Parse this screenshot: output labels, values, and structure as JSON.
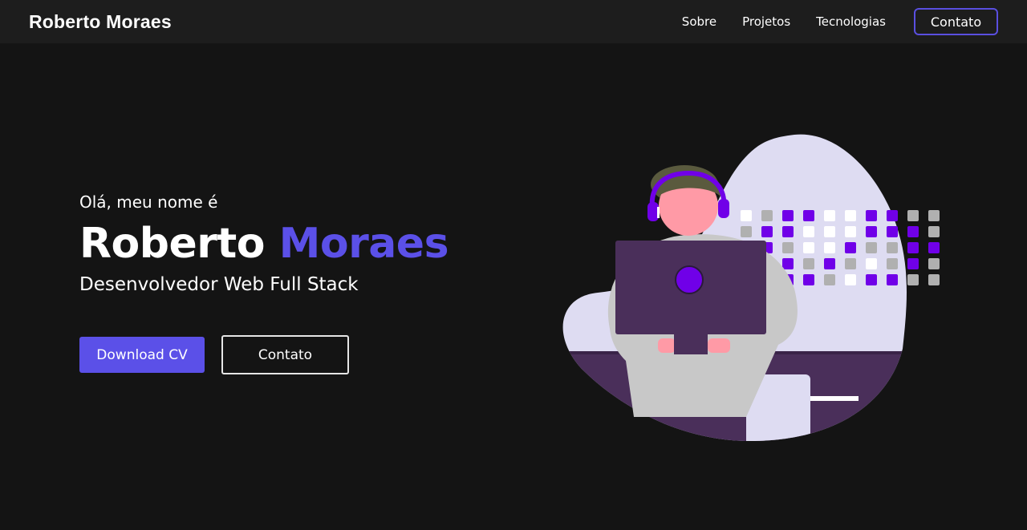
{
  "navbar": {
    "brand": "Roberto Moraes",
    "links": [
      "Sobre",
      "Projetos",
      "Tecnologias"
    ],
    "contact_label": "Contato"
  },
  "hero": {
    "greeting": "Olá, meu nome é",
    "name_first": "Roberto",
    "name_last": "Moraes",
    "role": "Desenvolvedor Web Full Stack",
    "download_label": "Download CV",
    "contact_label": "Contato"
  },
  "colors": {
    "background": "#141414",
    "navbar": "#1d1d1d",
    "accent": "#5b50e8",
    "blob": "#dedcf2",
    "desk": "#4a2f5a",
    "pixel_purple": "#7000e8",
    "pixel_gray": "#b0b0b0",
    "pixel_white": "#ffffff"
  },
  "illustration": {
    "icon": "developer-at-computer-illustration"
  }
}
